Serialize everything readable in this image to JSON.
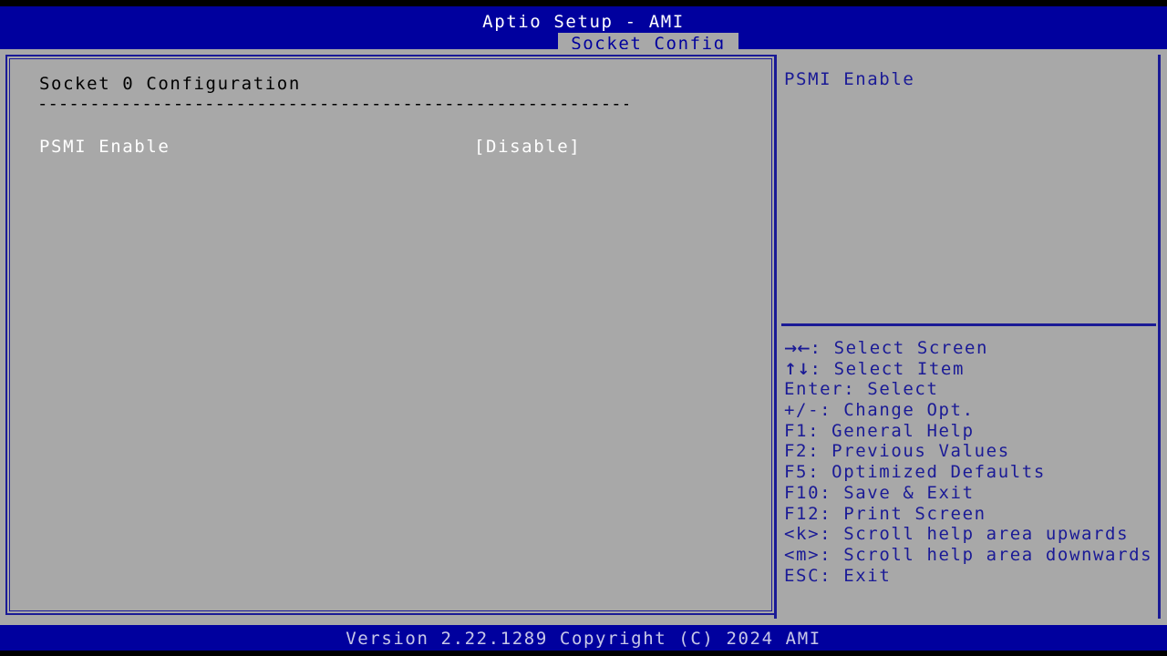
{
  "colors": {
    "title_bar_bg": "#00009e",
    "panel_bg": "#a8a8a8",
    "border_blue": "#1a1a96",
    "help_text": "#1a1a96",
    "option_text": "#ffffff",
    "heading_text": "#000000",
    "footer_text": "#c8c8e8",
    "screen_black": "#000000"
  },
  "header": {
    "title": "Aptio Setup - AMI",
    "tabs": [
      {
        "label": "Socket Config",
        "active": true
      }
    ]
  },
  "main": {
    "section_heading": "Socket 0 Configuration",
    "section_rule": "----------------------------------------------------------",
    "options": [
      {
        "label": "PSMI Enable",
        "value": "[Disable]",
        "selected": false
      }
    ]
  },
  "help": {
    "title": "PSMI Enable",
    "description": "",
    "keys": [
      {
        "glyph": "→←",
        "key": "",
        "text": ": Select Screen"
      },
      {
        "glyph": "↑↓",
        "key": "",
        "text": ": Select Item"
      },
      {
        "glyph": "",
        "key": "Enter",
        "text": ": Select"
      },
      {
        "glyph": "",
        "key": "+/-",
        "text": ": Change Opt."
      },
      {
        "glyph": "",
        "key": "F1",
        "text": ": General Help"
      },
      {
        "glyph": "",
        "key": "F2",
        "text": ": Previous Values"
      },
      {
        "glyph": "",
        "key": "F5",
        "text": ": Optimized Defaults"
      },
      {
        "glyph": "",
        "key": "F10",
        "text": ": Save & Exit"
      },
      {
        "glyph": "",
        "key": "F12",
        "text": ": Print Screen"
      },
      {
        "glyph": "",
        "key": "<k>",
        "text": ": Scroll help area upwards"
      },
      {
        "glyph": "",
        "key": "<m>",
        "text": ": Scroll help area downwards"
      },
      {
        "glyph": "",
        "key": "ESC",
        "text": ": Exit"
      }
    ]
  },
  "footer": {
    "version_text": "Version 2.22.1289 Copyright (C) 2024 AMI"
  }
}
